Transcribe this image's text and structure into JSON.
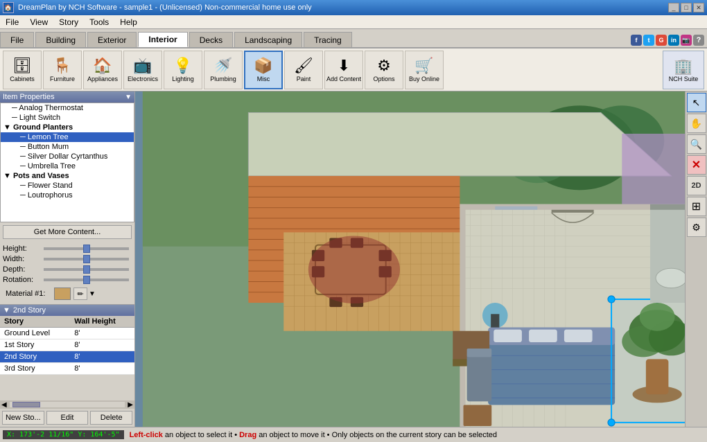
{
  "titlebar": {
    "title": "DreamPlan by NCH Software - sample1 - (Unlicensed) Non-commercial home use only",
    "icon": "🏠",
    "controls": [
      "_",
      "□",
      "✕"
    ]
  },
  "menubar": {
    "items": [
      "File",
      "View",
      "Story",
      "Tools",
      "Help"
    ]
  },
  "tabs": {
    "items": [
      "File",
      "Building",
      "Exterior",
      "Interior",
      "Decks",
      "Landscaping",
      "Tracing"
    ],
    "active": "Interior"
  },
  "social": [
    "f",
    "t",
    "G+",
    "in",
    "📷"
  ],
  "toolbar": {
    "buttons": [
      {
        "id": "cabinets",
        "label": "Cabinets",
        "icon": "🗄"
      },
      {
        "id": "furniture",
        "label": "Furniture",
        "icon": "🪑"
      },
      {
        "id": "appliances",
        "label": "Appliances",
        "icon": "🏠"
      },
      {
        "id": "electronics",
        "label": "Electronics",
        "icon": "📺"
      },
      {
        "id": "lighting",
        "label": "Lighting",
        "icon": "💡"
      },
      {
        "id": "plumbing",
        "label": "Plumbing",
        "icon": "🚿"
      },
      {
        "id": "misc",
        "label": "Misc",
        "icon": "📦"
      },
      {
        "id": "paint",
        "label": "Paint",
        "icon": "🖌"
      },
      {
        "id": "add_content",
        "label": "Add Content",
        "icon": "➕"
      },
      {
        "id": "options",
        "label": "Options",
        "icon": "⚙"
      },
      {
        "id": "buy_online",
        "label": "Buy Online",
        "icon": "🛒"
      }
    ],
    "active": "misc",
    "nch_suite": "NCH Suite"
  },
  "item_properties": {
    "header": "Item Properties",
    "tree": [
      {
        "label": "Analog Thermostat",
        "indent": 1,
        "selected": false
      },
      {
        "label": "Light Switch",
        "indent": 1,
        "selected": false
      },
      {
        "label": "Ground Planters",
        "indent": 0,
        "group": true,
        "selected": false
      },
      {
        "label": "Lemon Tree",
        "indent": 2,
        "selected": true
      },
      {
        "label": "Button Mum",
        "indent": 2,
        "selected": false
      },
      {
        "label": "Silver Dollar Cyrtanthus",
        "indent": 2,
        "selected": false
      },
      {
        "label": "Umbrella Tree",
        "indent": 2,
        "selected": false
      },
      {
        "label": "Pots and Vases",
        "indent": 0,
        "group": true,
        "selected": false
      },
      {
        "label": "Flower Stand",
        "indent": 2,
        "selected": false
      },
      {
        "label": "Loutrophorus",
        "indent": 2,
        "selected": false
      }
    ],
    "get_more_label": "Get More Content...",
    "sliders": [
      {
        "label": "Height:",
        "value": 50
      },
      {
        "label": "Width:",
        "value": 50
      },
      {
        "label": "Depth:",
        "value": 50
      },
      {
        "label": "Rotation:",
        "value": 50
      }
    ],
    "material_label": "Material #1:"
  },
  "story_panel": {
    "header": "2nd Story",
    "columns": [
      "Story",
      "Wall Height"
    ],
    "rows": [
      {
        "story": "Ground Level",
        "height": "8'",
        "selected": false
      },
      {
        "story": "1st Story",
        "height": "8'",
        "selected": false
      },
      {
        "story": "2nd Story",
        "height": "8'",
        "selected": true
      },
      {
        "story": "3rd Story",
        "height": "8'",
        "selected": false
      }
    ],
    "buttons": [
      "New Sto...",
      "Edit",
      "Delete"
    ]
  },
  "statusbar": {
    "coords": "X: 173'-2 11/16\"  Y: 164'-5\"",
    "hint": "Left-click an object to select it • Drag an object to move it • Only objects on the current story can be selected"
  },
  "right_toolbar": {
    "buttons": [
      {
        "id": "cursor",
        "icon": "↖",
        "active": true
      },
      {
        "id": "hand",
        "icon": "✋",
        "active": false
      },
      {
        "id": "zoom_in",
        "icon": "🔍",
        "active": false
      },
      {
        "id": "delete_red",
        "icon": "✕",
        "active": false,
        "red": true
      },
      {
        "id": "2d_toggle",
        "icon": "2D",
        "active": false,
        "twod": true
      },
      {
        "id": "layers",
        "icon": "≡",
        "active": false
      },
      {
        "id": "settings",
        "icon": "⚙",
        "active": false
      }
    ]
  }
}
